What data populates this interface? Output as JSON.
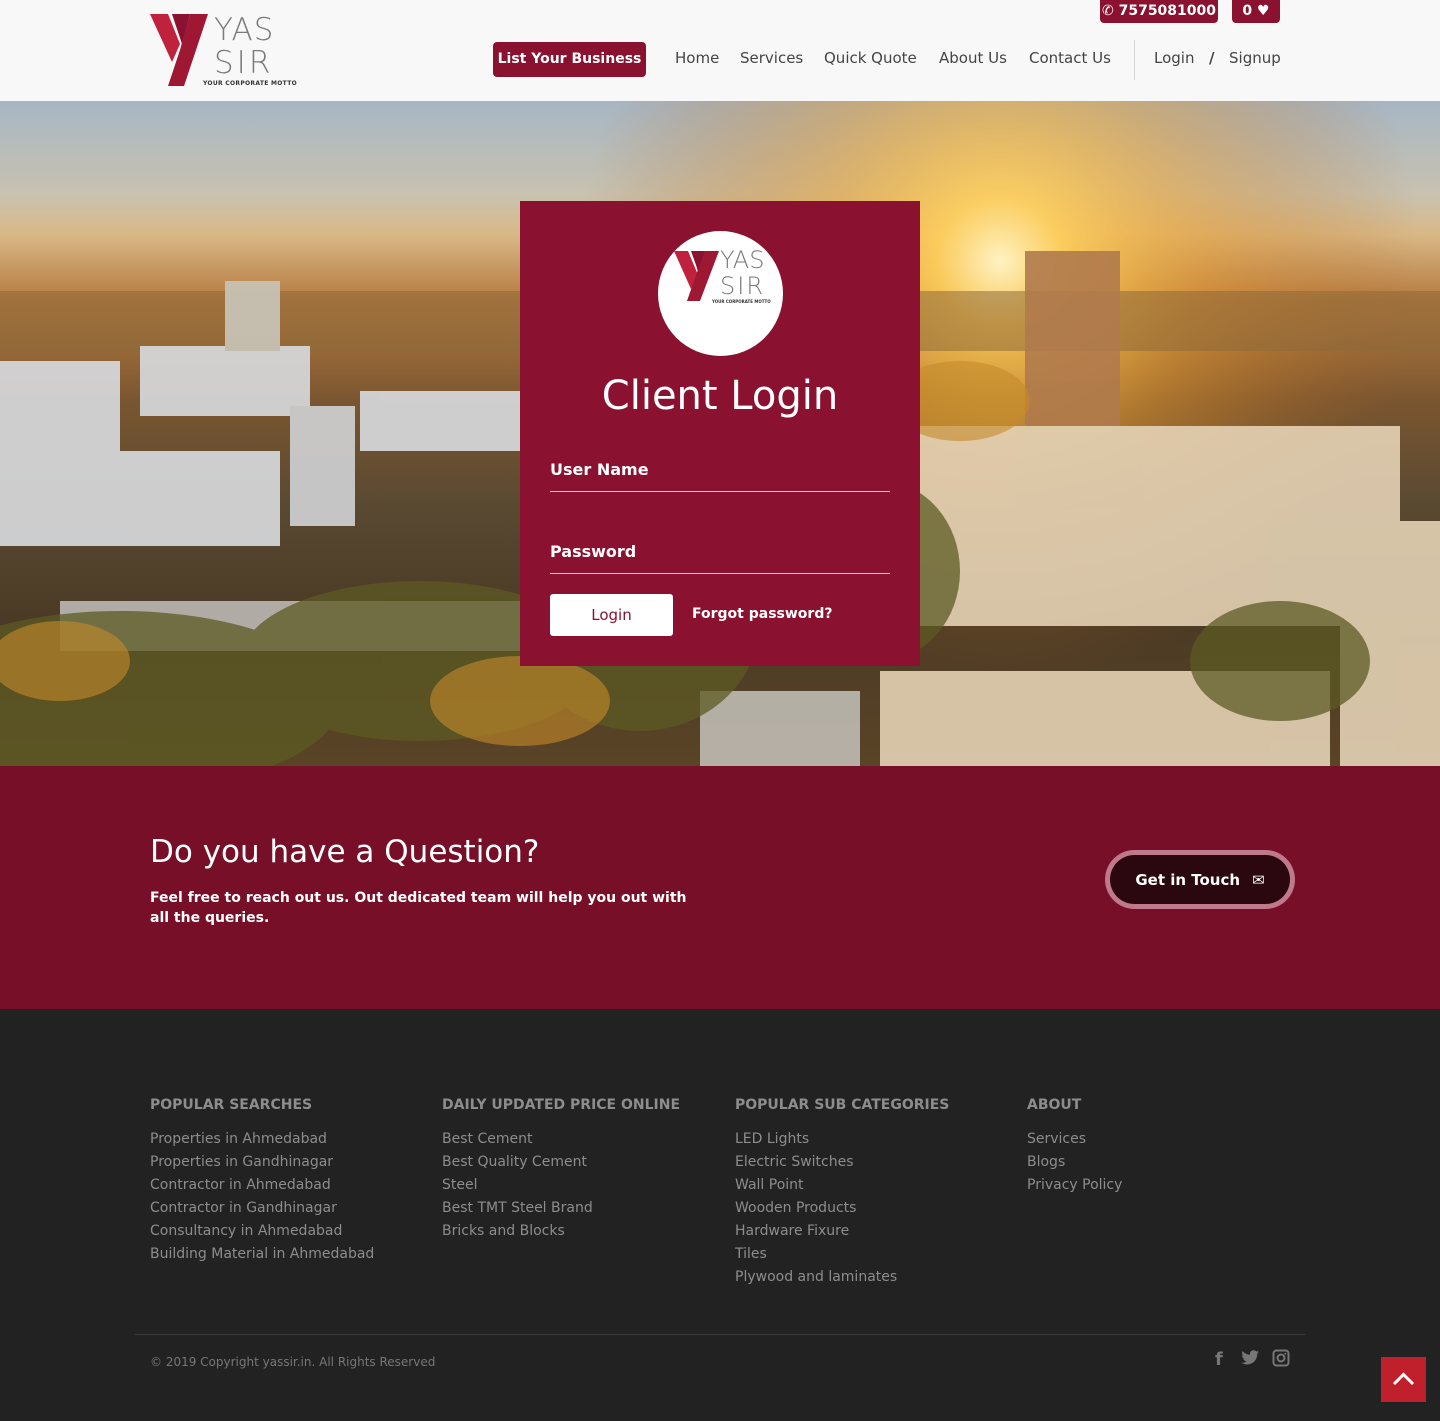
{
  "brand": {
    "line1": "YAS",
    "line2": "SIR",
    "motto": "YOUR CORPORATE MOTTO",
    "primary_color": "#8a1230",
    "band_color": "#770f28",
    "footer_color": "#222222"
  },
  "topbar": {
    "phone": "7575081000",
    "phone_icon": "phone-icon",
    "favorites_count": "0",
    "favorites_icon": "heart-icon"
  },
  "nav": {
    "list_business": "List Your Business",
    "items": [
      "Home",
      "Services",
      "Quick Quote",
      "About Us",
      "Contact Us"
    ],
    "login": "Login",
    "separator": "/",
    "signup": "Signup"
  },
  "login_card": {
    "title": "Client Login",
    "username_label": "User Name",
    "password_label": "Password",
    "login_button": "Login",
    "forgot_link": "Forgot password?"
  },
  "question": {
    "title": "Do you have a Question?",
    "text": "Feel free to reach out us. Out dedicated team will help you out with all the queries.",
    "button": "Get in Touch",
    "button_icon": "envelope-icon"
  },
  "footer": {
    "columns": [
      {
        "title": "POPULAR SEARCHES",
        "links": [
          "Properties in Ahmedabad",
          "Properties in Gandhinagar",
          "Contractor in Ahmedabad",
          "Contractor in Gandhinagar",
          "Consultancy in Ahmedabad",
          "Building Material in Ahmedabad"
        ]
      },
      {
        "title": "DAILY UPDATED PRICE ONLINE",
        "links": [
          "Best Cement",
          "Best Quality Cement",
          "Steel",
          "Best TMT Steel Brand",
          "Bricks and Blocks"
        ]
      },
      {
        "title": "POPULAR SUB CATEGORIES",
        "links": [
          "LED Lights",
          "Electric Switches",
          "Wall Point",
          "Wooden Products",
          "Hardware Fixure",
          "Tiles",
          "Plywood and laminates"
        ]
      },
      {
        "title": "ABOUT",
        "links": [
          "Services",
          "Blogs",
          "Privacy Policy"
        ]
      }
    ],
    "copyright": "© 2019 Copyright yassir.in. All Rights Reserved",
    "social_icons": [
      "facebook-icon",
      "twitter-icon",
      "instagram-icon"
    ],
    "back_to_top_icon": "chevron-up-icon"
  }
}
